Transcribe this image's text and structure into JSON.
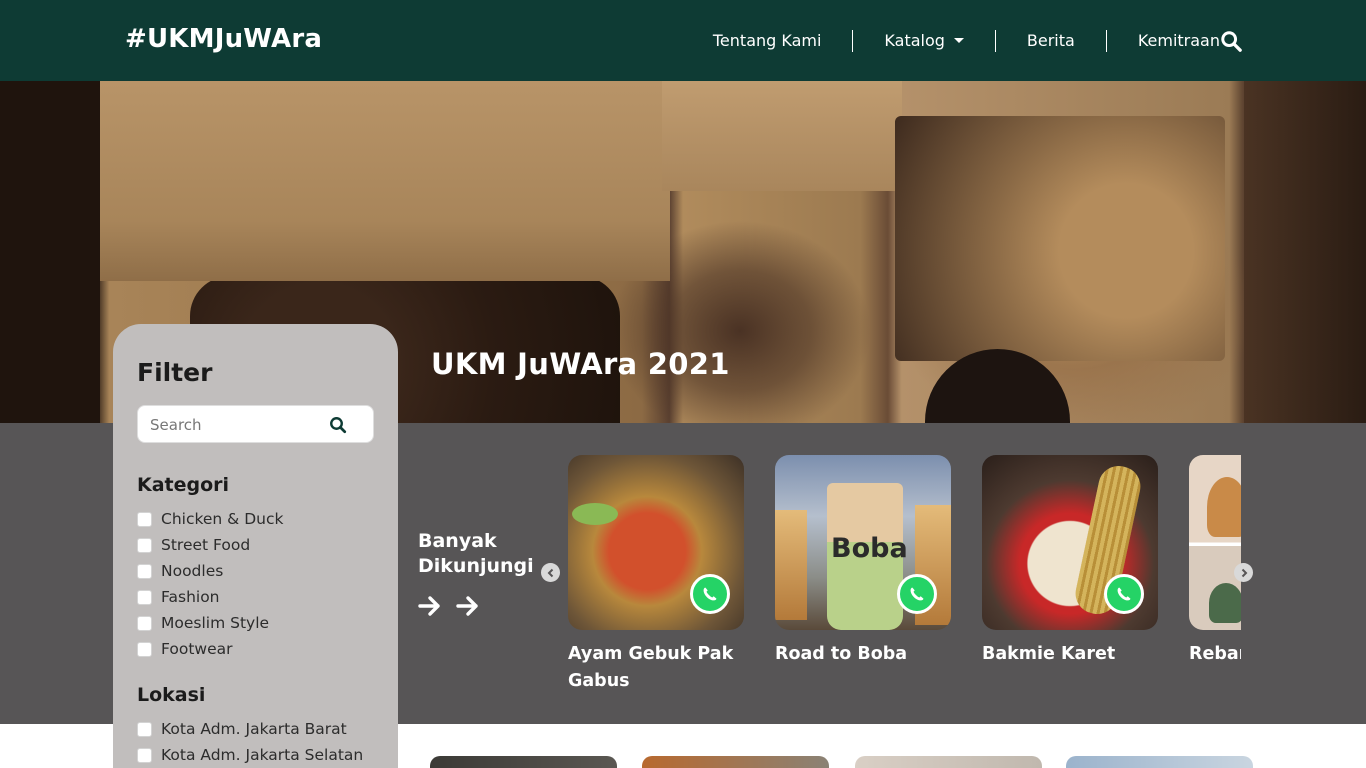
{
  "navbar": {
    "brand": "#UKMJuWAra",
    "links": [
      {
        "label": "Tentang Kami"
      },
      {
        "label": "Katalog"
      },
      {
        "label": "Berita"
      },
      {
        "label": "Kemitraan"
      }
    ],
    "search_icon": "search-icon",
    "bg_color": "#0e3b34"
  },
  "hero": {
    "title": "UKM JuWAra 2021"
  },
  "popular": {
    "title_line1": "Banyak",
    "title_line2": "Dikunjungi",
    "items": [
      {
        "name": "Ayam Gebuk Pak Gabus"
      },
      {
        "name": "Road to Boba"
      },
      {
        "name": "Bakmie Karet"
      },
      {
        "name": "Rebana"
      }
    ],
    "boba_cup_text": "Boba",
    "band_color": "#575556"
  },
  "filter": {
    "title": "Filter",
    "search_placeholder": "Search",
    "kategori_title": "Kategori",
    "kategori": [
      "Chicken & Duck",
      "Street Food",
      "Noodles",
      "Fashion",
      "Moeslim Style",
      "Footwear"
    ],
    "lokasi_title": "Lokasi",
    "lokasi": [
      "Kota Adm. Jakarta Barat",
      "Kota Adm. Jakarta Selatan"
    ],
    "bg_color": "#c1bebd"
  }
}
